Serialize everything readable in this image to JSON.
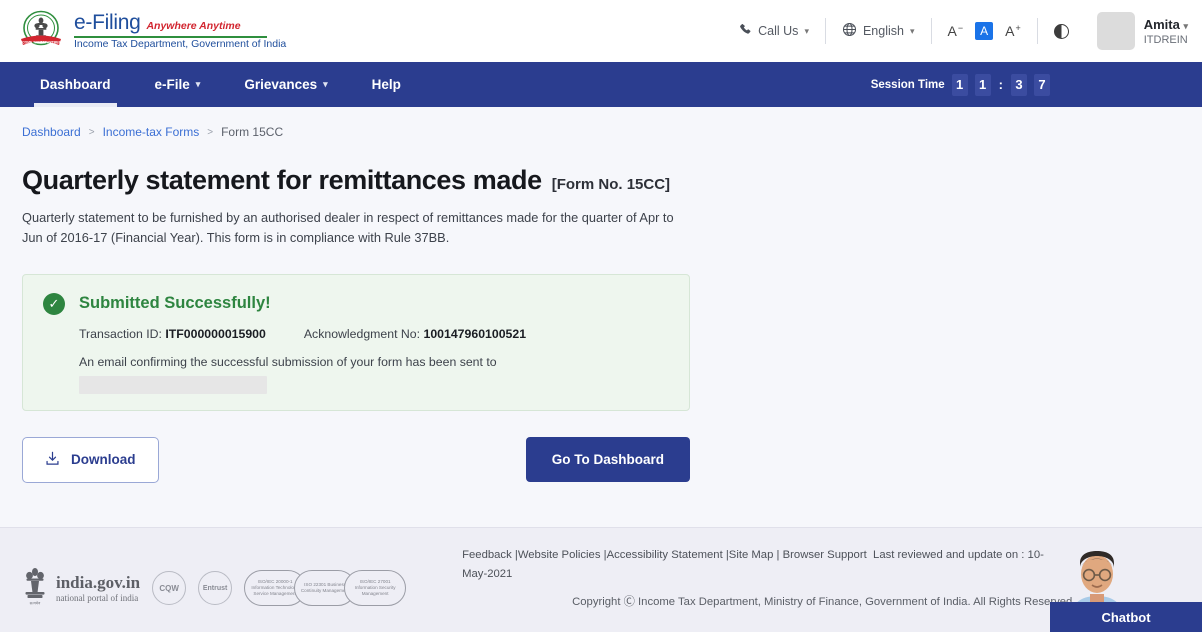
{
  "header": {
    "brand": {
      "name": "e-Filing",
      "tagline": "Anywhere Anytime",
      "department": "Income Tax Department, Government of India"
    },
    "call_us": "Call Us",
    "language": "English",
    "text_size": {
      "decrease": "A",
      "normal": "A",
      "increase": "A"
    },
    "user": {
      "name": "Amita",
      "id": "ITDREIN"
    }
  },
  "nav": {
    "items": [
      {
        "label": "Dashboard",
        "has_caret": false,
        "active": true
      },
      {
        "label": "e-File",
        "has_caret": true,
        "active": false
      },
      {
        "label": "Grievances",
        "has_caret": true,
        "active": false
      },
      {
        "label": "Help",
        "has_caret": false,
        "active": false
      }
    ],
    "session_label": "Session Time",
    "session_digits": [
      "1",
      "1",
      "3",
      "7"
    ],
    "session_time": "11:37"
  },
  "breadcrumb": {
    "items": [
      "Dashboard",
      "Income-tax Forms",
      "Form 15CC"
    ],
    "separator": ">"
  },
  "page": {
    "title": "Quarterly statement for remittances made",
    "form_no": "[Form No. 15CC]",
    "description": "Quarterly statement to be furnished by an authorised dealer in respect of remittances made for the quarter of Apr to Jun of 2016-17 (Financial Year). This form is in compliance with Rule 37BB."
  },
  "success": {
    "title": "Submitted Successfully!",
    "transaction_label": "Transaction ID:",
    "transaction_id": "ITF000000015900",
    "ack_label": "Acknowledgment No:",
    "ack_no": "100147960100521",
    "email_note": "An email confirming the successful submission of your form has been sent to"
  },
  "actions": {
    "download": "Download",
    "go_dashboard": "Go To Dashboard"
  },
  "footer": {
    "india_gov_title": "india.gov.in",
    "india_gov_sub": "national portal of india",
    "cqw_badge": "CQW",
    "entrust_badge": "Entrust",
    "iso_badges": [
      "ISO/IEC 20000-1 Information Technology Service Management",
      "ISO 22301 Business Continuity Management",
      "ISO/IEC 27001 Information Security Management"
    ],
    "links": [
      "Feedback",
      "Website Policies",
      "Accessibility Statement",
      "Site Map",
      "Browser Support"
    ],
    "last_reviewed": "Last reviewed and update on : 10-May-2021",
    "copyright": "Copyright Ⓒ Income Tax Department, Ministry of Finance, Government of India. All Rights Reserved"
  },
  "chatbot": {
    "label": "Chatbot"
  },
  "colors": {
    "nav_blue": "#2b3d8f",
    "success_green": "#2e8540",
    "link_blue": "#3b6fd4",
    "accent_blue": "#1a73e8"
  }
}
